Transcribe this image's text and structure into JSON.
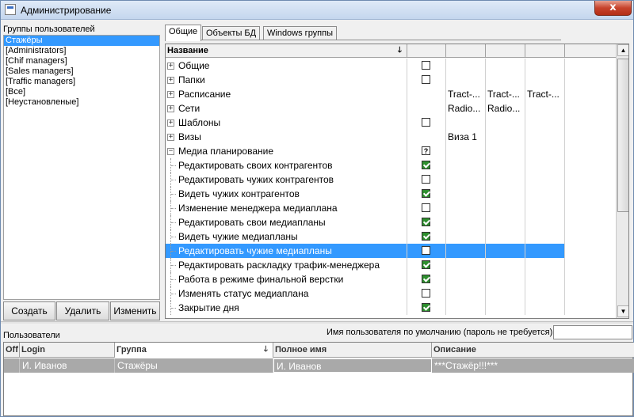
{
  "window": {
    "title": "Администрирование",
    "close_glyph": "x"
  },
  "groups": {
    "label": "Группы пользователей",
    "items": [
      "Стажёры",
      "[Administrators]",
      "[Chif managers]",
      "[Sales managers]",
      "[Traffic managers]",
      "[Все]",
      "[Неустановленые]"
    ],
    "selected_index": 0,
    "buttons": {
      "create": "Создать",
      "delete": "Удалить",
      "edit": "Изменить"
    }
  },
  "tabs": [
    "Общие",
    "Объекты БД",
    "Windows группы"
  ],
  "active_tab": 0,
  "permissions": {
    "header_name": "Название",
    "sort_arrow": "🡓",
    "rows": [
      {
        "name": "Общие",
        "kind": "group",
        "expander": "+",
        "check": "off",
        "c1": "",
        "c2": "",
        "c3": ""
      },
      {
        "name": "Папки",
        "kind": "group",
        "expander": "+",
        "check": "off",
        "c1": "",
        "c2": "",
        "c3": ""
      },
      {
        "name": "Расписание",
        "kind": "group",
        "expander": "+",
        "check": "none",
        "c1": "Tract-...",
        "c2": "Tract-...",
        "c3": "Tract-..."
      },
      {
        "name": "Сети",
        "kind": "group",
        "expander": "+",
        "check": "none",
        "c1": "Radio...",
        "c2": "Radio...",
        "c3": ""
      },
      {
        "name": "Шаблоны",
        "kind": "group",
        "expander": "+",
        "check": "off",
        "c1": "",
        "c2": "",
        "c3": ""
      },
      {
        "name": "Визы",
        "kind": "group",
        "expander": "+",
        "check": "none",
        "c1": "Виза 1",
        "c2": "",
        "c3": ""
      },
      {
        "name": "Медиа планирование",
        "kind": "group",
        "expander": "−",
        "check": "partial",
        "c1": "",
        "c2": "",
        "c3": ""
      },
      {
        "name": "Редактировать своих контрагентов",
        "kind": "child",
        "check": "on",
        "c1": "",
        "c2": "",
        "c3": ""
      },
      {
        "name": "Редактировать чужих контрагентов",
        "kind": "child",
        "check": "off",
        "c1": "",
        "c2": "",
        "c3": ""
      },
      {
        "name": "Видеть чужих контрагентов",
        "kind": "child",
        "check": "on",
        "c1": "",
        "c2": "",
        "c3": ""
      },
      {
        "name": "Изменение менеджера медиаплана",
        "kind": "child",
        "check": "off",
        "c1": "",
        "c2": "",
        "c3": ""
      },
      {
        "name": "Редактировать свои медиапланы",
        "kind": "child",
        "check": "on",
        "c1": "",
        "c2": "",
        "c3": ""
      },
      {
        "name": "Видеть чужие медиапланы",
        "kind": "child",
        "check": "on",
        "c1": "",
        "c2": "",
        "c3": ""
      },
      {
        "name": "Редактировать чужие медиапланы",
        "kind": "child",
        "check": "off",
        "selected": true,
        "c1": "",
        "c2": "",
        "c3": ""
      },
      {
        "name": "Редактировать раскладку трафик-менеджера",
        "kind": "child",
        "check": "on",
        "c1": "",
        "c2": "",
        "c3": ""
      },
      {
        "name": "Работа в режиме финальной верстки",
        "kind": "child",
        "check": "on",
        "c1": "",
        "c2": "",
        "c3": ""
      },
      {
        "name": "Изменять статус медиаплана",
        "kind": "child",
        "check": "off",
        "c1": "",
        "c2": "",
        "c3": ""
      },
      {
        "name": "Закрытие дня",
        "kind": "child",
        "check": "on",
        "c1": "",
        "c2": "",
        "c3": ""
      }
    ],
    "partial_glyph": "?"
  },
  "users": {
    "label": "Пользователи",
    "default_user_label": "Имя пользователя по умолчанию (пароль не требуется)",
    "default_user_value": "",
    "columns": {
      "off": "Off",
      "login": "Login",
      "group": "Группа",
      "fullname": "Полное имя",
      "description": "Описание"
    },
    "sort_arrow": "🡓",
    "rows": [
      {
        "off": "",
        "login": "И. Иванов",
        "group": "Стажёры",
        "fullname": "И. Иванов",
        "description": "***Стажёр!!!***"
      }
    ]
  },
  "scroll": {
    "up": "▲",
    "down": "▼"
  }
}
